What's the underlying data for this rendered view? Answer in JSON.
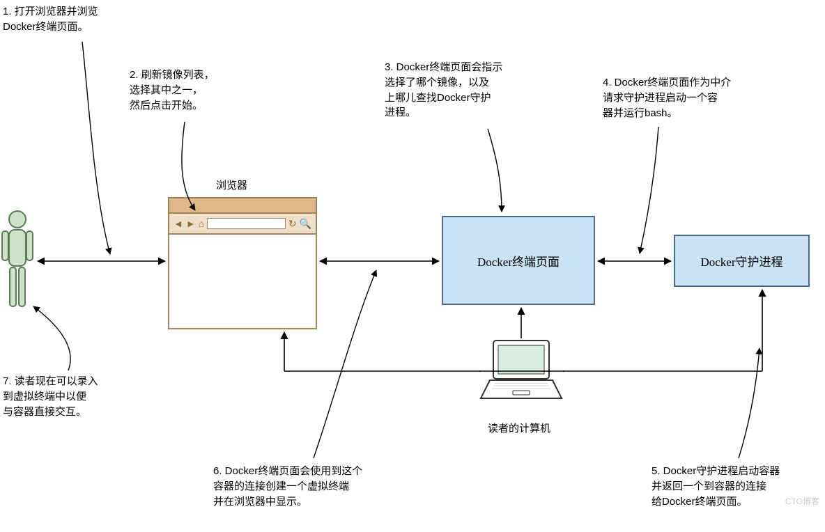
{
  "steps": {
    "s1": "1. 打开浏览器并浏览\n    Docker终端页面。",
    "s2": "2. 刷新镜像列表，\n    选择其中之一，\n    然后点击开始。",
    "s3": "3. Docker终端页面会指示\n    选择了哪个镜像，以及\n    上哪儿查找Docker守护\n    进程。",
    "s4": "4. Docker终端页面作为中介\n    请求守护进程启动一个容\n    器并运行bash。",
    "s5": "5. Docker守护进程启动容器\n    并返回一个到容器的连接\n    给Docker终端页面。",
    "s6": "6. Docker终端页面会使用到这个\n    容器的连接创建一个虚拟终端\n    并在浏览器中显示。",
    "s7": "7. 读者现在可以录入\n    到虚拟终端中以便\n    与容器直接交互。"
  },
  "labels": {
    "browser": "浏览器",
    "docker_terminal": "Docker终端页面",
    "docker_daemon": "Docker守护进程",
    "reader_computer": "读者的计算机"
  },
  "watermark": "CTO博客"
}
